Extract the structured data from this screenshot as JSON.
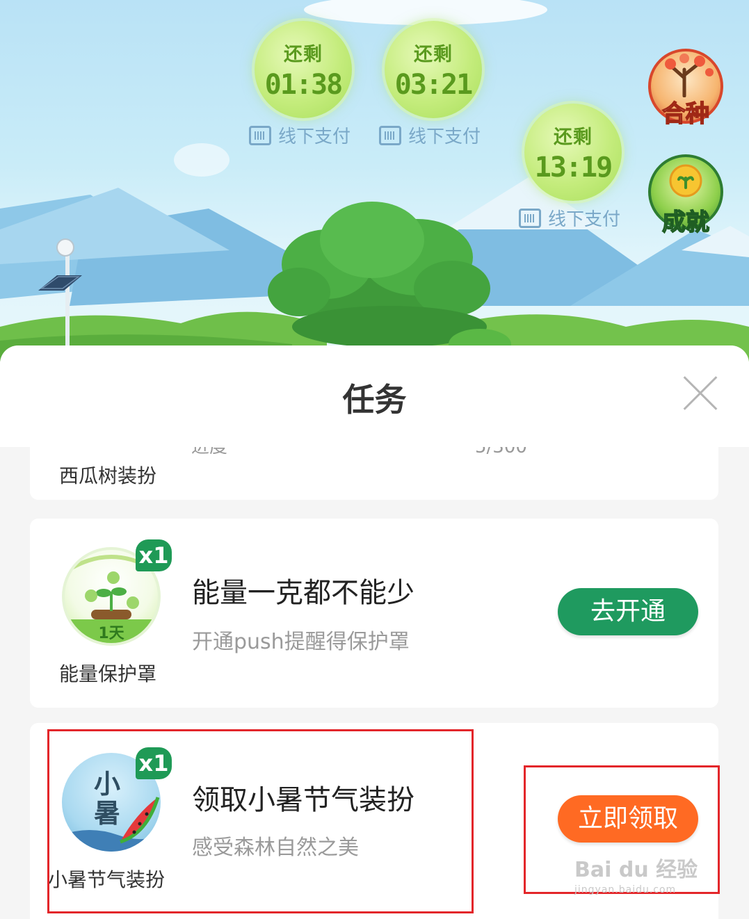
{
  "scene": {
    "energy_balls": [
      {
        "label": "还剩",
        "time": "01:38",
        "offline_label": "线下支付"
      },
      {
        "label": "还剩",
        "time": "03:21",
        "offline_label": "线下支付"
      },
      {
        "label": "还剩",
        "time": "13:19",
        "offline_label": "线下支付"
      }
    ],
    "side_buttons": {
      "plant_together": "合种",
      "achievement": "成就"
    }
  },
  "panel": {
    "title": "任务",
    "partial_task": {
      "reward_label": "西瓜树装扮"
    },
    "tasks": [
      {
        "reward_label": "能量保护罩",
        "reward_count": "x1",
        "reward_icon_text": "1天",
        "title": "能量一克都不能少",
        "description": "开通push提醒得保护罩",
        "action": "去开通",
        "action_color": "#1f9a5f"
      },
      {
        "reward_label": "小暑节气装扮",
        "reward_count": "x1",
        "reward_icon_text": "小暑",
        "title": "领取小暑节气装扮",
        "description": "感受森林自然之美",
        "action": "立即领取",
        "action_color": "#ff6a23"
      }
    ]
  },
  "watermark": {
    "brand": "Bai du 经验",
    "url": "jingyan.baidu.com"
  }
}
